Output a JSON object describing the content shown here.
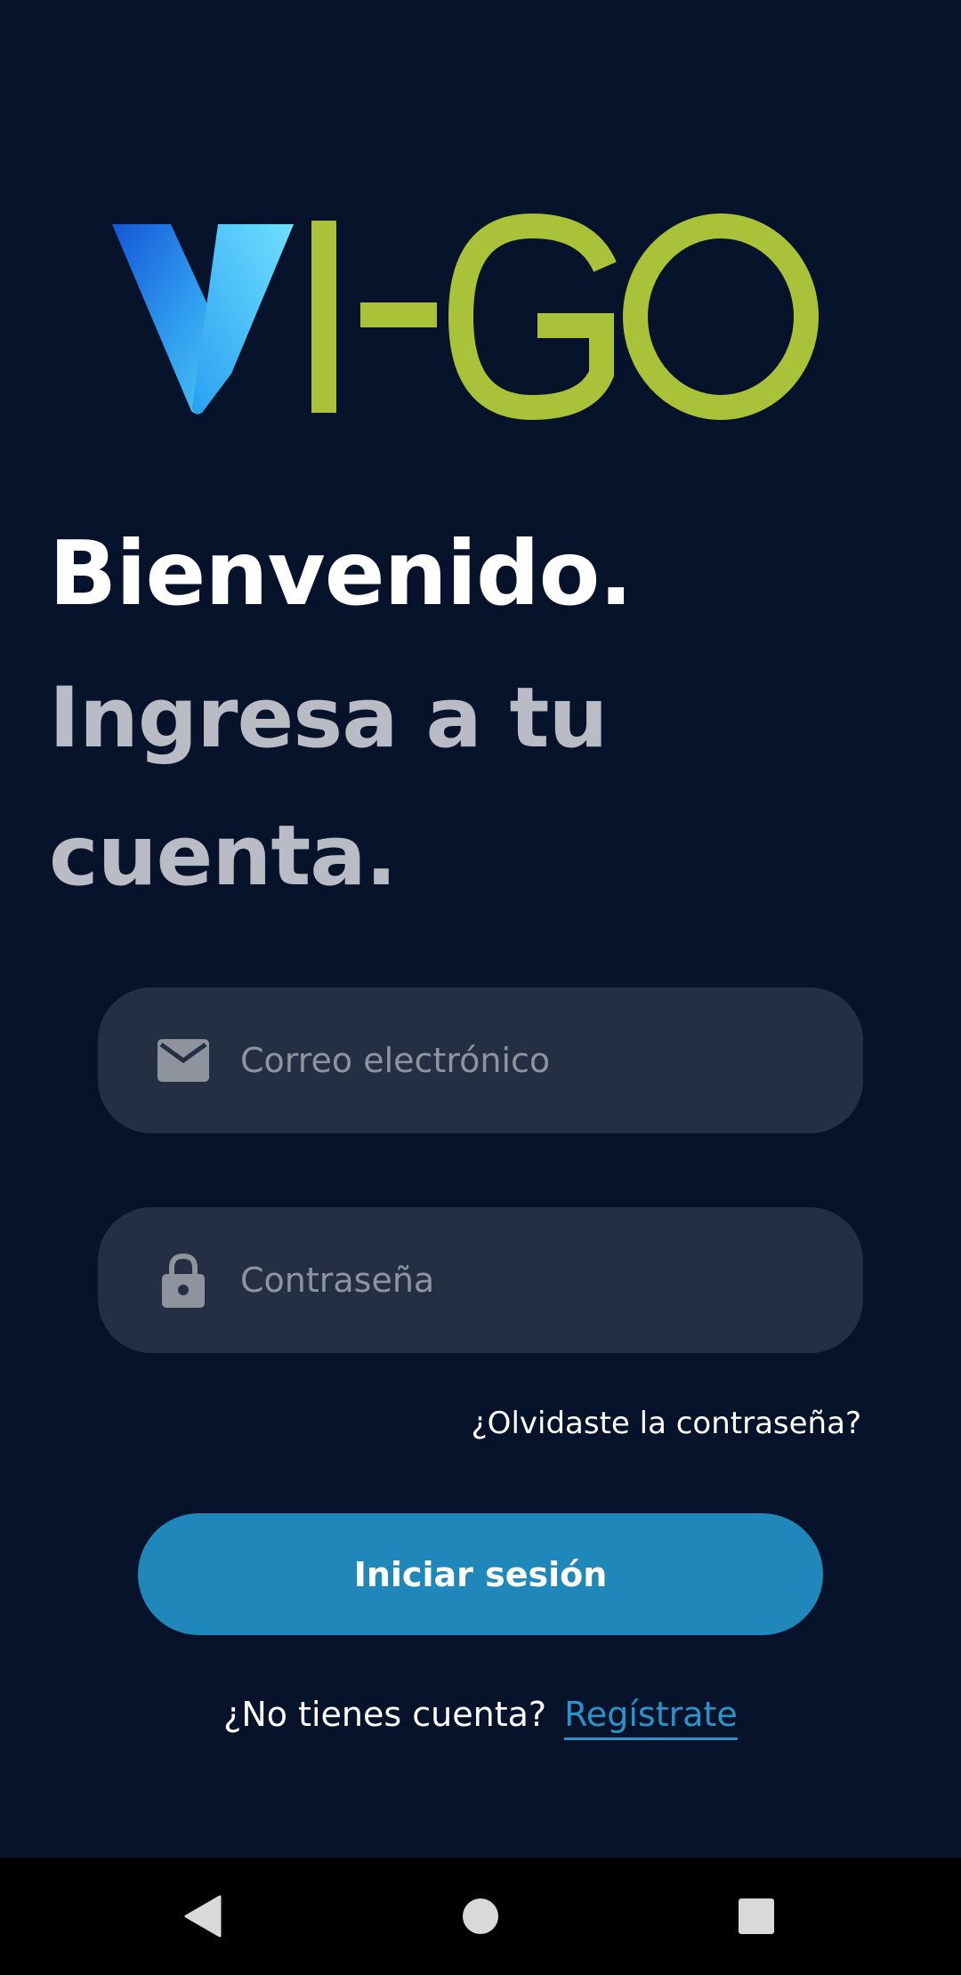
{
  "logo": {
    "text": "VI-GO",
    "colors": {
      "v_light": "#52c8f5",
      "v_dark": "#1556d6",
      "letters": "#a9c23a"
    }
  },
  "heading": {
    "welcome": "Bienvenido.",
    "subtitle": "Ingresa a tu cuenta."
  },
  "form": {
    "email_placeholder": "Correo electrónico",
    "email_value": "",
    "password_placeholder": "Contraseña",
    "password_value": "",
    "email_icon": "mail-icon",
    "password_icon": "lock-icon"
  },
  "forgot_password": "¿Olvidaste la contraseña?",
  "login_button": "Iniciar sesión",
  "signup": {
    "prompt": "¿No tienes cuenta?",
    "link": "Regístrate"
  },
  "navbar": {
    "icons": [
      "back-icon",
      "home-icon",
      "recents-icon"
    ]
  },
  "colors": {
    "background": "#07132b",
    "field_bg": "#242f44",
    "accent": "#1f87b9",
    "link": "#2a93c9",
    "subtitle_text": "#b9bcc4"
  }
}
